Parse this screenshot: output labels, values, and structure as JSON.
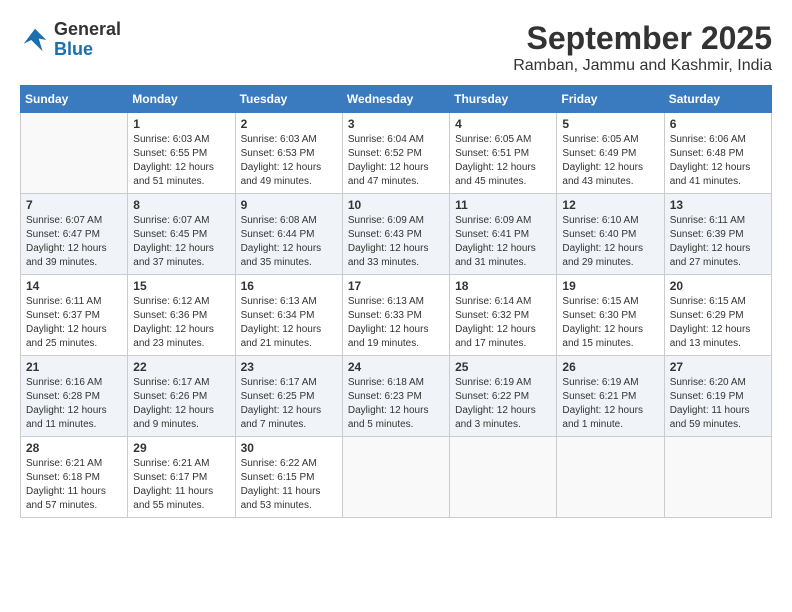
{
  "header": {
    "logo_line1": "General",
    "logo_line2": "Blue",
    "title": "September 2025",
    "subtitle": "Ramban, Jammu and Kashmir, India"
  },
  "weekdays": [
    "Sunday",
    "Monday",
    "Tuesday",
    "Wednesday",
    "Thursday",
    "Friday",
    "Saturday"
  ],
  "weeks": [
    [
      {
        "date": "",
        "info": ""
      },
      {
        "date": "1",
        "info": "Sunrise: 6:03 AM\nSunset: 6:55 PM\nDaylight: 12 hours\nand 51 minutes."
      },
      {
        "date": "2",
        "info": "Sunrise: 6:03 AM\nSunset: 6:53 PM\nDaylight: 12 hours\nand 49 minutes."
      },
      {
        "date": "3",
        "info": "Sunrise: 6:04 AM\nSunset: 6:52 PM\nDaylight: 12 hours\nand 47 minutes."
      },
      {
        "date": "4",
        "info": "Sunrise: 6:05 AM\nSunset: 6:51 PM\nDaylight: 12 hours\nand 45 minutes."
      },
      {
        "date": "5",
        "info": "Sunrise: 6:05 AM\nSunset: 6:49 PM\nDaylight: 12 hours\nand 43 minutes."
      },
      {
        "date": "6",
        "info": "Sunrise: 6:06 AM\nSunset: 6:48 PM\nDaylight: 12 hours\nand 41 minutes."
      }
    ],
    [
      {
        "date": "7",
        "info": "Sunrise: 6:07 AM\nSunset: 6:47 PM\nDaylight: 12 hours\nand 39 minutes."
      },
      {
        "date": "8",
        "info": "Sunrise: 6:07 AM\nSunset: 6:45 PM\nDaylight: 12 hours\nand 37 minutes."
      },
      {
        "date": "9",
        "info": "Sunrise: 6:08 AM\nSunset: 6:44 PM\nDaylight: 12 hours\nand 35 minutes."
      },
      {
        "date": "10",
        "info": "Sunrise: 6:09 AM\nSunset: 6:43 PM\nDaylight: 12 hours\nand 33 minutes."
      },
      {
        "date": "11",
        "info": "Sunrise: 6:09 AM\nSunset: 6:41 PM\nDaylight: 12 hours\nand 31 minutes."
      },
      {
        "date": "12",
        "info": "Sunrise: 6:10 AM\nSunset: 6:40 PM\nDaylight: 12 hours\nand 29 minutes."
      },
      {
        "date": "13",
        "info": "Sunrise: 6:11 AM\nSunset: 6:39 PM\nDaylight: 12 hours\nand 27 minutes."
      }
    ],
    [
      {
        "date": "14",
        "info": "Sunrise: 6:11 AM\nSunset: 6:37 PM\nDaylight: 12 hours\nand 25 minutes."
      },
      {
        "date": "15",
        "info": "Sunrise: 6:12 AM\nSunset: 6:36 PM\nDaylight: 12 hours\nand 23 minutes."
      },
      {
        "date": "16",
        "info": "Sunrise: 6:13 AM\nSunset: 6:34 PM\nDaylight: 12 hours\nand 21 minutes."
      },
      {
        "date": "17",
        "info": "Sunrise: 6:13 AM\nSunset: 6:33 PM\nDaylight: 12 hours\nand 19 minutes."
      },
      {
        "date": "18",
        "info": "Sunrise: 6:14 AM\nSunset: 6:32 PM\nDaylight: 12 hours\nand 17 minutes."
      },
      {
        "date": "19",
        "info": "Sunrise: 6:15 AM\nSunset: 6:30 PM\nDaylight: 12 hours\nand 15 minutes."
      },
      {
        "date": "20",
        "info": "Sunrise: 6:15 AM\nSunset: 6:29 PM\nDaylight: 12 hours\nand 13 minutes."
      }
    ],
    [
      {
        "date": "21",
        "info": "Sunrise: 6:16 AM\nSunset: 6:28 PM\nDaylight: 12 hours\nand 11 minutes."
      },
      {
        "date": "22",
        "info": "Sunrise: 6:17 AM\nSunset: 6:26 PM\nDaylight: 12 hours\nand 9 minutes."
      },
      {
        "date": "23",
        "info": "Sunrise: 6:17 AM\nSunset: 6:25 PM\nDaylight: 12 hours\nand 7 minutes."
      },
      {
        "date": "24",
        "info": "Sunrise: 6:18 AM\nSunset: 6:23 PM\nDaylight: 12 hours\nand 5 minutes."
      },
      {
        "date": "25",
        "info": "Sunrise: 6:19 AM\nSunset: 6:22 PM\nDaylight: 12 hours\nand 3 minutes."
      },
      {
        "date": "26",
        "info": "Sunrise: 6:19 AM\nSunset: 6:21 PM\nDaylight: 12 hours\nand 1 minute."
      },
      {
        "date": "27",
        "info": "Sunrise: 6:20 AM\nSunset: 6:19 PM\nDaylight: 11 hours\nand 59 minutes."
      }
    ],
    [
      {
        "date": "28",
        "info": "Sunrise: 6:21 AM\nSunset: 6:18 PM\nDaylight: 11 hours\nand 57 minutes."
      },
      {
        "date": "29",
        "info": "Sunrise: 6:21 AM\nSunset: 6:17 PM\nDaylight: 11 hours\nand 55 minutes."
      },
      {
        "date": "30",
        "info": "Sunrise: 6:22 AM\nSunset: 6:15 PM\nDaylight: 11 hours\nand 53 minutes."
      },
      {
        "date": "",
        "info": ""
      },
      {
        "date": "",
        "info": ""
      },
      {
        "date": "",
        "info": ""
      },
      {
        "date": "",
        "info": ""
      }
    ]
  ]
}
